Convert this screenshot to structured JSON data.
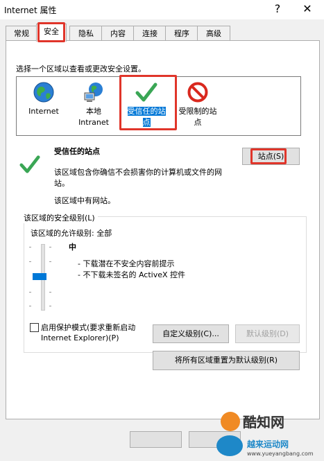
{
  "window": {
    "title": "Internet 属性",
    "help_glyph": "?",
    "close_glyph": "✕"
  },
  "tabs": [
    {
      "label": "常规"
    },
    {
      "label": "安全"
    },
    {
      "label": "隐私"
    },
    {
      "label": "内容"
    },
    {
      "label": "连接"
    },
    {
      "label": "程序"
    },
    {
      "label": "高级"
    }
  ],
  "security": {
    "instruction": "选择一个区域以查看或更改安全设置。",
    "zones": [
      {
        "label_line1": "Internet",
        "label_line2": "",
        "icon": "globe-icon"
      },
      {
        "label_line1": "本地",
        "label_line2": "Intranet",
        "icon": "intranet-icon"
      },
      {
        "label_line1": "受信任的站",
        "label_line2": "点",
        "icon": "checkmark-icon"
      },
      {
        "label_line1": "受限制的站",
        "label_line2": "点",
        "icon": "restricted-icon"
      }
    ],
    "selected_zone": {
      "name": "受信任的站点",
      "desc_line1": "该区域包含你确信不会损害你的计算机或文件的网",
      "desc_line2": "站。",
      "status": "该区域中有网站。",
      "sites_button": "站点(S)"
    },
    "level_group": {
      "title": "该区域的安全级别(L)",
      "allowed": "该区域的允许级别: 全部",
      "level_name": "中",
      "bullet1": "- 下载潜在不安全内容前提示",
      "bullet2": "- 不下载未签名的 ActiveX 控件"
    },
    "protected_mode_line1": "启用保护模式(要求重新启动",
    "protected_mode_line2": "Internet Explorer)(P)",
    "custom_level_button": "自定义级别(C)...",
    "default_level_button": "默认级别(D)",
    "reset_all_button": "将所有区域重置为默认级别(R)"
  },
  "watermark": {
    "text1": "酷知网",
    "text2": "越来运动网",
    "text3": "www.yueyangbang.com"
  },
  "colors": {
    "accent": "#0078d7",
    "highlight_box": "#e0352a",
    "check_green": "#3aa655",
    "restricted_red": "#d9281e"
  }
}
